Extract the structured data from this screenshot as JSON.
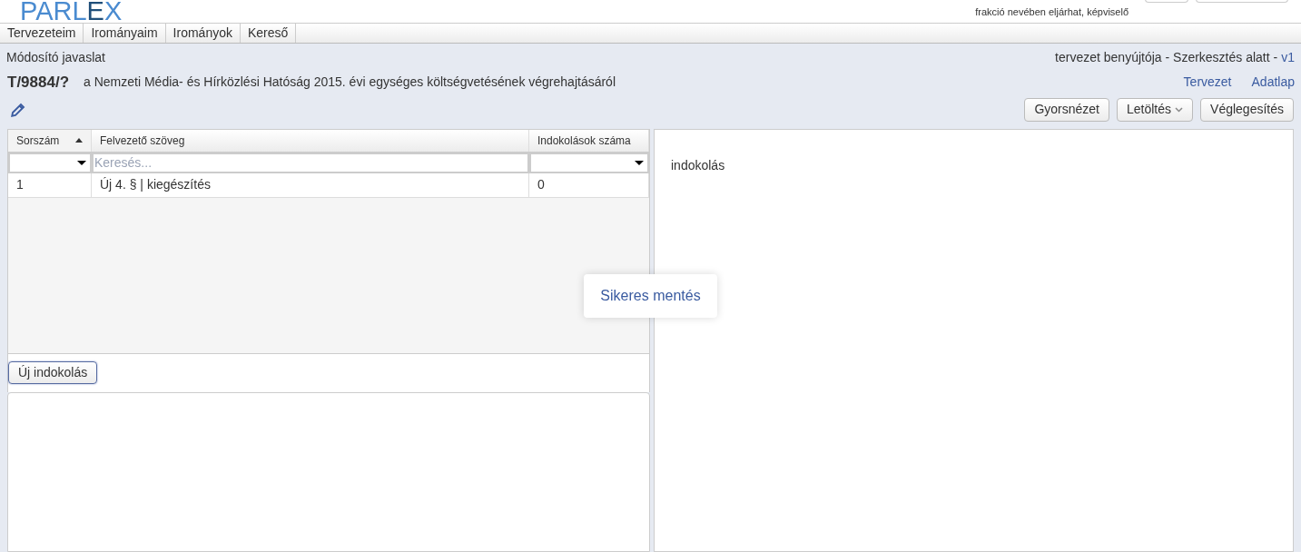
{
  "header": {
    "logo_parts": [
      {
        "text": "PARL",
        "accent": false
      },
      {
        "text": "E",
        "accent": true
      },
      {
        "text": "X",
        "accent": false
      }
    ],
    "user_role": "frakció nevében eljárhat, képviselő"
  },
  "menu": [
    {
      "label": "Tervezeteim"
    },
    {
      "label": "Irományaim"
    },
    {
      "label": "Irományok"
    },
    {
      "label": "Kereső"
    }
  ],
  "document": {
    "type": "Módosító javaslat",
    "status": "tervezet benyújtója - Szerkesztés alatt -",
    "version": "v1",
    "number": "T/9884/?",
    "title": "a Nemzeti Média- és Hírközlési Hatóság 2015. évi egységes költségvetésének végrehajtásáról",
    "links": [
      "Tervezet",
      "Adatlap"
    ]
  },
  "toolbar": [
    {
      "label": "Gyorsnézet",
      "kind": "plain"
    },
    {
      "label": "Letöltés",
      "kind": "dropdown"
    },
    {
      "label": "Véglegesítés",
      "kind": "plain"
    }
  ],
  "table": {
    "columns": [
      {
        "label": "Sorszám",
        "sorted": true,
        "kind": "select"
      },
      {
        "label": "Felvezető szöveg",
        "sorted": false,
        "kind": "text",
        "placeholder": "Keresés..."
      },
      {
        "label": "Indokolások száma",
        "sorted": false,
        "kind": "select"
      }
    ],
    "rows": [
      [
        "1",
        "Új 4. § | kiegészítés",
        "0"
      ]
    ]
  },
  "new_button": "Új indokolás",
  "right_panel": {
    "text": "indokolás"
  },
  "toast": "Sikeres mentés"
}
